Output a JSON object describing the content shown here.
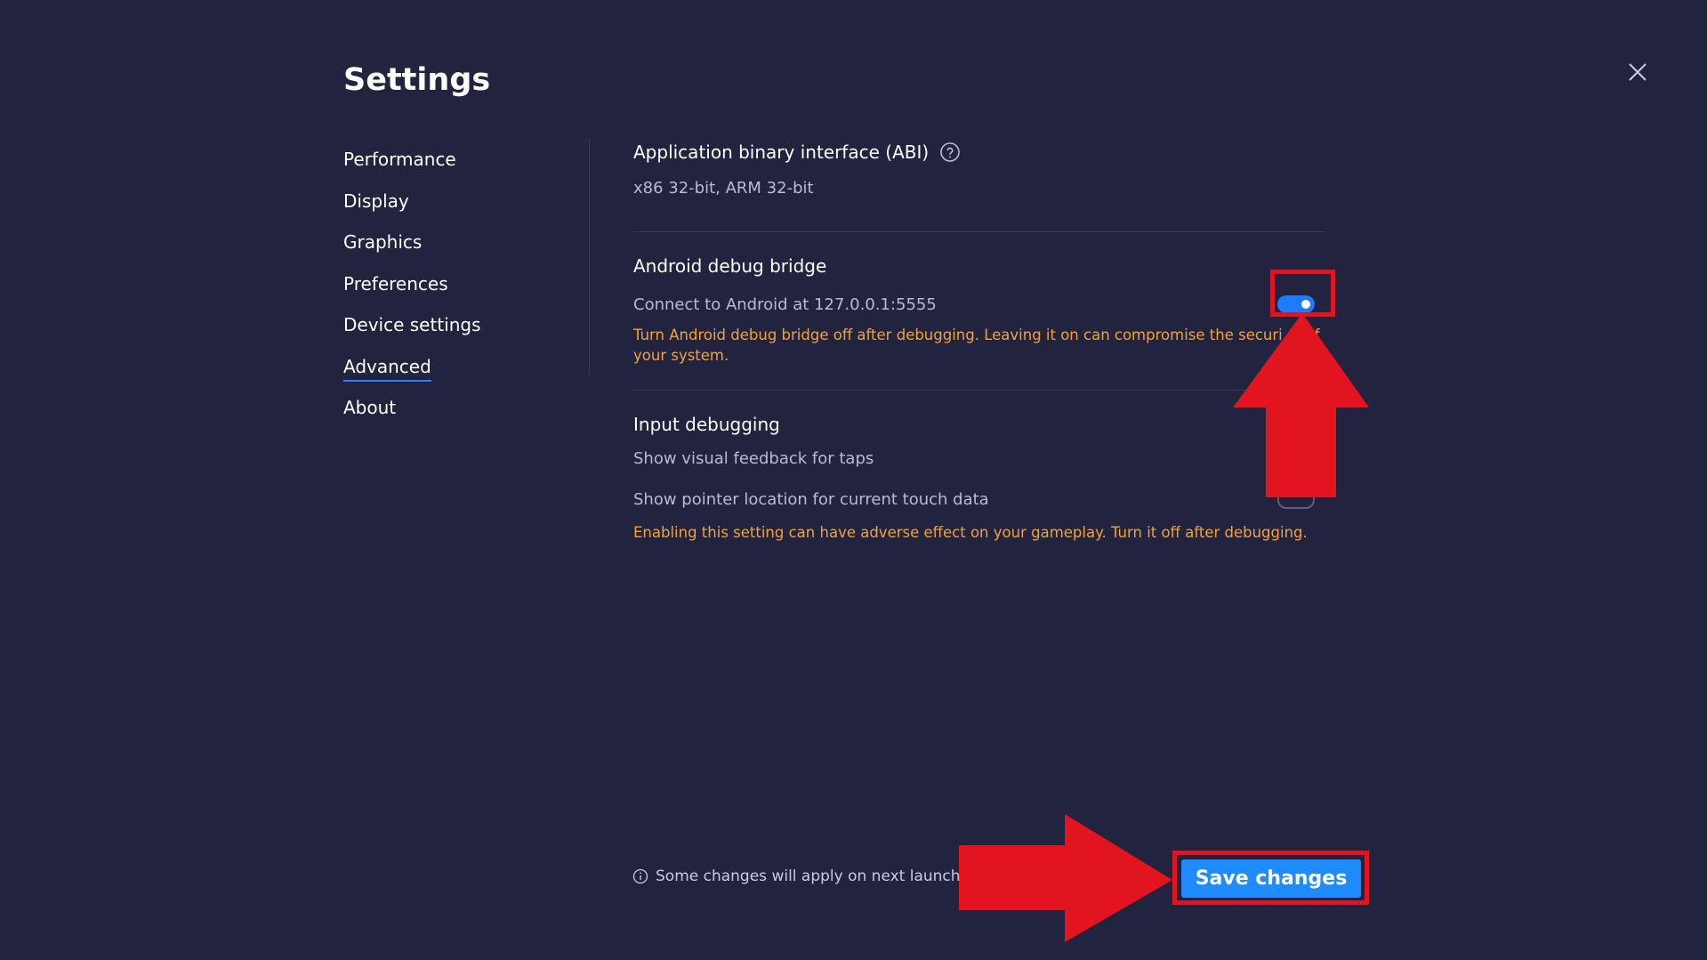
{
  "page": {
    "title": "Settings"
  },
  "nav": {
    "items": [
      {
        "label": "Performance",
        "active": false
      },
      {
        "label": "Display",
        "active": false
      },
      {
        "label": "Graphics",
        "active": false
      },
      {
        "label": "Preferences",
        "active": false
      },
      {
        "label": "Device settings",
        "active": false
      },
      {
        "label": "Advanced",
        "active": true
      },
      {
        "label": "About",
        "active": false
      }
    ]
  },
  "abi": {
    "title": "Application binary interface (ABI)",
    "value": "x86 32-bit, ARM 32-bit",
    "help_icon": "question-circle-icon"
  },
  "adb": {
    "title": "Android debug bridge",
    "connect_label": "Connect to Android at 127.0.0.1:5555",
    "enabled": true,
    "warning_line1": "Turn Android debug bridge off after debugging. Leaving it on can compromise the securi",
    "warning_line1_end": "f",
    "warning_line2": "your system."
  },
  "input_debugging": {
    "title": "Input debugging",
    "taps_label": "Show visual feedback for taps",
    "pointer_label": "Show pointer location for current touch data",
    "pointer_enabled": false,
    "warning": "Enabling this setting can have adverse effect on your gameplay. Turn it off after  debugging."
  },
  "footer": {
    "note": "Some changes will apply on next launch",
    "info_icon": "info-circle-icon",
    "save_label": "Save changes"
  },
  "colors": {
    "background": "#22243f",
    "accent": "#1e8bff",
    "warning": "#f2a23a",
    "annotation": "#e2141f"
  }
}
